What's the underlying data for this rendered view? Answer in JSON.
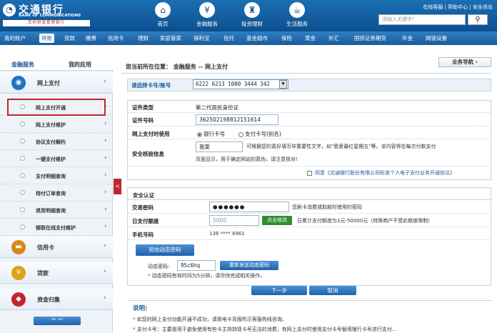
{
  "header": {
    "bank_name_cn": "交通银行",
    "bank_name_en": "BANK OF COMMUNICATIONS",
    "slogan": "您的财富管理银行",
    "nav": [
      {
        "label": "首页",
        "icon": "home-icon",
        "glyph": "⌂"
      },
      {
        "label": "金融服务",
        "icon": "wallet-icon",
        "glyph": "¥"
      },
      {
        "label": "投资理财",
        "icon": "lock-icon",
        "glyph": "♜"
      },
      {
        "label": "生活服务",
        "icon": "coffee-icon",
        "glyph": "☕"
      }
    ],
    "top_links": "在线客服 | 帮助中心 | 安全退出",
    "search_placeholder": "请输入关键字!",
    "search_icon": "search-icon"
  },
  "menubar": {
    "items": [
      "我的账户",
      "转账",
      "贷款",
      "缴费",
      "信用卡",
      "理财",
      "家庭管家",
      "得利宝",
      "信托",
      "基金超市",
      "保险",
      "黄金",
      "外汇",
      "国债证券期货",
      "年金",
      "网银设置"
    ],
    "active_index": 1
  },
  "sidebar": {
    "tabs": [
      "金融服务",
      "我的应用"
    ],
    "categories": [
      {
        "label": "网上支付",
        "icon": "online-pay-icon",
        "glyph": "◉",
        "color": "#1e73c2"
      },
      {
        "label": "信用卡",
        "icon": "credit-card-icon",
        "glyph": "▬",
        "color": "#d8891b"
      },
      {
        "label": "贷款",
        "icon": "loan-icon",
        "glyph": "¥",
        "color": "#e0a21a"
      },
      {
        "label": "资金归集",
        "icon": "fund-collect-icon",
        "glyph": "◆",
        "color": "#c0262d"
      }
    ],
    "sub_items": [
      "网上支付开通",
      "网上支付维护",
      "协议支付解约",
      "一键支付维护",
      "支付明细查询",
      "待付订单查询",
      "退货明细查询",
      "银联在线支付维护"
    ],
    "active_sub_index": 0,
    "collapse_glyph": "<",
    "more_glyph": "︾  ︾"
  },
  "main": {
    "breadcrumb": "您当前所在位置： 金融服务 -- 网上支付",
    "guide_button": "业务导航 ›",
    "card_label": "请选择卡号/账号",
    "card_value": "6222 6213 1000 3444 342",
    "id_type_label": "证件类型",
    "id_type_value": "第二代居民身份证",
    "id_number_label": "证件号码",
    "id_number_value": "362502198812151614",
    "pay_use_label": "网上支付时使用",
    "pay_option_card": "银行卡号",
    "pay_option_alias": "支付卡号(别名)",
    "security_label": "安全核验信息",
    "security_value": "我爱",
    "security_hint_1": "可根据您的喜好填写非重要性文字，如\"我爱最红星期五\"等。该内容将在每次付款支付",
    "security_hint_2": "页面显示，用于确定网站的真伪，请注意核对!",
    "agreement_text": "同意《交通银行股份有限公司标准个人电子支付业务开通协议》",
    "auth_title": "安全认证",
    "trade_pwd_label": "交易密码",
    "trade_pwd_value": "●●●●●●",
    "trade_pwd_hint": "您刷卡消费或取款时使用的密码",
    "daily_limit_label": "日支付额度",
    "daily_limit_value": "5000",
    "daily_limit_btn": "点击修改",
    "daily_limit_hint": "日累计支付额度为1元-50000元（特殊商户不受此额度限制）",
    "phone_label": "手机号码",
    "phone_value": "138 **** 4961",
    "sms_button": "短信动态密码",
    "dynamic_label": "动态密码:",
    "dynamic_value": "95c6hq",
    "resend_button": "重新发送动态密码",
    "dynamic_hint": "动态密码有效时间为5分钟，请尽快完成相关操作。",
    "next_button": "下一步",
    "cancel_button": "取消",
    "notes_title": "说明:",
    "notes_1": "如您的网上支付功能开通不成功，请致电卡背面所示客服热线咨询。",
    "notes_2": "支付卡号：主要是用于避免使用有些卡主持持现卡号无法的消费，有网上支付时使用支付卡号替用银行卡号进行支付..."
  }
}
